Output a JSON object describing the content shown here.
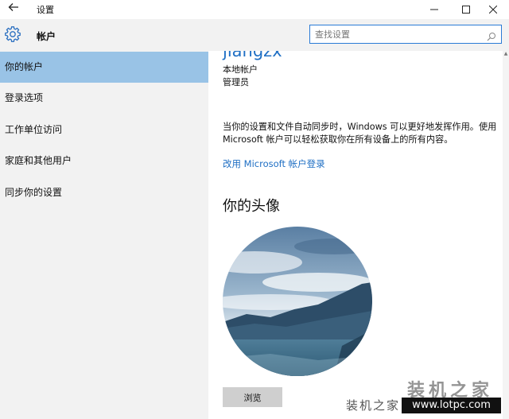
{
  "window": {
    "title": "设置",
    "back_icon": "back-arrow-icon",
    "controls": [
      "minimize-icon",
      "maximize-icon",
      "close-icon"
    ]
  },
  "header": {
    "icon": "gear-icon",
    "title": "帐户",
    "search_placeholder": "查找设置",
    "search_icon": "search-icon"
  },
  "sidebar": {
    "selected_color": "#99c3e6",
    "items": [
      {
        "label": "你的帐户",
        "selected": true
      },
      {
        "label": "登录选项",
        "selected": false
      },
      {
        "label": "工作单位访问",
        "selected": false
      },
      {
        "label": "家庭和其他用户",
        "selected": false
      },
      {
        "label": "同步你的设置",
        "selected": false
      }
    ]
  },
  "account": {
    "username": "jiangzx",
    "type": "本地帐户",
    "role": "管理员",
    "sync_text": "当你的设置和文件自动同步时，Windows 可以更好地发挥作用。使用 Microsoft 帐户可以轻松获取你在所有设备上的所有内容。",
    "switch_link": "改用 Microsoft 帐户登录",
    "link_color": "#1f6fc4"
  },
  "avatar": {
    "heading": "你的头像",
    "browse_label": "浏览"
  },
  "watermark": {
    "logo": "装机之家",
    "site": "装机之家",
    "url": "www.lotpc.com"
  }
}
